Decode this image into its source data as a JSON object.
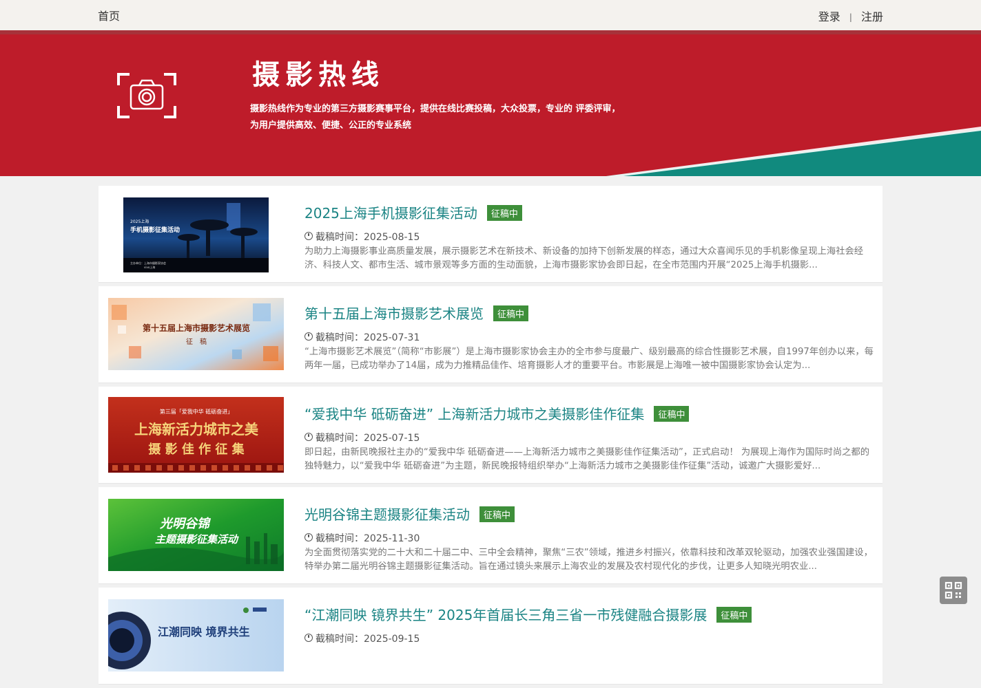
{
  "nav": {
    "home": "首页",
    "login": "登录",
    "separator": "|",
    "register": "注册"
  },
  "banner": {
    "title": "摄影热线",
    "description_line1": "摄影热线作为专业的第三方摄影赛事平台，提供在线比赛投稿，大众投票，专业的 评委评审，",
    "description_line2": "为用户提供高效、便捷、公正的专业系统",
    "icon": "camera-icon"
  },
  "date_label": "截稿时间：",
  "items": [
    {
      "title": "2025上海手机摄影征集活动",
      "badge": "征稿中",
      "deadline": "2025-08-15",
      "summary": "为助力上海摄影事业高质量发展，展示摄影艺术在新技术、新设备的加持下创新发展的样态，通过大众喜闻乐见的手机影像呈现上海社会经济、科技人文、都市生活、城市景观等多方面的生动面貌，上海市摄影家协会即日起，在全市范围内开展“2025上海手机摄影...",
      "thumb_line1": "2025上海",
      "thumb_line2": "手机摄影征集活动",
      "thumb_footer1": "主办单位：上海市摄影家协会",
      "thumb_footer2": "vivo上海"
    },
    {
      "title": "第十五届上海市摄影艺术展览",
      "badge": "征稿中",
      "deadline": "2025-07-31",
      "summary": "“上海市摄影艺术展览”（简称“市影展”）是上海市摄影家协会主办的全市参与度最广、级别最高的综合性摄影艺术展，自1997年创办以来，每两年一届，已成功举办了14届，成为力推精品佳作、培育摄影人才的重要平台。市影展是上海唯一被中国摄影家协会认定为...",
      "thumb_line1": "第十五届上海市摄影艺术展览",
      "thumb_line2": "征　稿"
    },
    {
      "title": "“爱我中华 砥砺奋进” 上海新活力城市之美摄影佳作征集",
      "badge": "征稿中",
      "deadline": "2025-07-15",
      "summary": "即日起，由新民晚报社主办的“爱我中华 砥砺奋进——上海新活力城市之美摄影佳作征集活动”，正式启动！ 为展现上海作为国际时尚之都的独特魅力，以“爱我中华 砥砺奋进”为主题，新民晚报特组织举办“上海新活力城市之美摄影佳作征集”活动，诚邀广大摄影爱好...",
      "thumb_line0": "第三届「爱我中华 砥砺奋进」",
      "thumb_line1": "上海新活力城市之美",
      "thumb_line2": "摄 影 佳 作 征 集"
    },
    {
      "title": "光明谷锦主题摄影征集活动",
      "badge": "征稿中",
      "deadline": "2025-11-30",
      "summary": "为全面贯彻落实党的二十大和二十届二中、三中全会精神，聚焦“三农”领域，推进乡村振兴，依靠科技和改革双轮驱动，加强农业强国建设，特举办第二届光明谷锦主题摄影征集活动。旨在通过镜头来展示上海农业的发展及农村现代化的步伐，让更多人知晓光明农业...",
      "thumb_line1": "光明谷锦",
      "thumb_line2": "主题摄影征集活动"
    },
    {
      "title": "“江潮同映 镜界共生” 2025年首届长三角三省一市残健融合摄影展",
      "badge": "征稿中",
      "deadline": "2025-09-15",
      "summary": "",
      "thumb_line1": "江潮同映 境界共生"
    }
  ],
  "colors": {
    "banner_red": "#be1c2a",
    "banner_teal": "#118a7e",
    "title_teal": "#1b8484",
    "badge_green": "#3e8f3a"
  },
  "qr_button": "qr-code-icon"
}
